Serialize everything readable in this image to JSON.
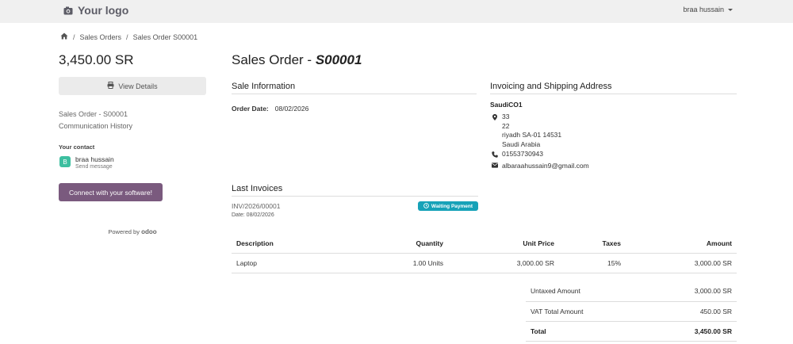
{
  "header": {
    "logo_text": "Your logo",
    "user_name": "braa hussain"
  },
  "breadcrumb": {
    "orders": "Sales Orders",
    "current": "Sales Order S00001"
  },
  "sidebar": {
    "amount": "3,450.00 SR",
    "view_details_label": "View Details",
    "link_order": "Sales Order - S00001",
    "link_history": "Communication History",
    "contact_heading": "Your contact",
    "contact_initial": "B",
    "contact_name": "braa hussain",
    "contact_action": "Send message",
    "connect_label": "Connect with your software!",
    "powered_by": "Powered by",
    "powered_brand": "odoo"
  },
  "order": {
    "title_prefix": "Sales Order - ",
    "number": "S00001"
  },
  "sale_info": {
    "heading": "Sale Information",
    "date_label": "Order Date:",
    "date_value": "08/02/2026"
  },
  "address": {
    "heading": "Invoicing and Shipping Address",
    "company": "SaudiCO1",
    "line1": "33",
    "line2": "22",
    "line3": "riyadh SA-01 14531",
    "line4": "Saudi Arabia",
    "phone": "01553730943",
    "email": "albaraahussain9@gmail.com"
  },
  "invoices": {
    "heading": "Last Invoices",
    "number": "INV/2026/00001",
    "date_text": "Date: 08/02/2026",
    "status": "Waiting Payment"
  },
  "lines": {
    "headers": {
      "description": "Description",
      "quantity": "Quantity",
      "unit_price": "Unit Price",
      "taxes": "Taxes",
      "amount": "Amount"
    },
    "rows": [
      {
        "description": "Laptop",
        "quantity": "1.00 Units",
        "unit_price": "3,000.00 SR",
        "taxes": "15%",
        "amount": "3,000.00 SR"
      }
    ]
  },
  "totals": {
    "untaxed_label": "Untaxed Amount",
    "untaxed_value": "3,000.00 SR",
    "vat_label": "VAT Total Amount",
    "vat_value": "450.00 SR",
    "total_label": "Total",
    "total_value": "3,450.00 SR"
  },
  "colors": {
    "topbar": "#f0f0f0",
    "connect_button": "#7a5a7e",
    "badge": "#17a2b8",
    "avatar": "#3dbfa0"
  }
}
